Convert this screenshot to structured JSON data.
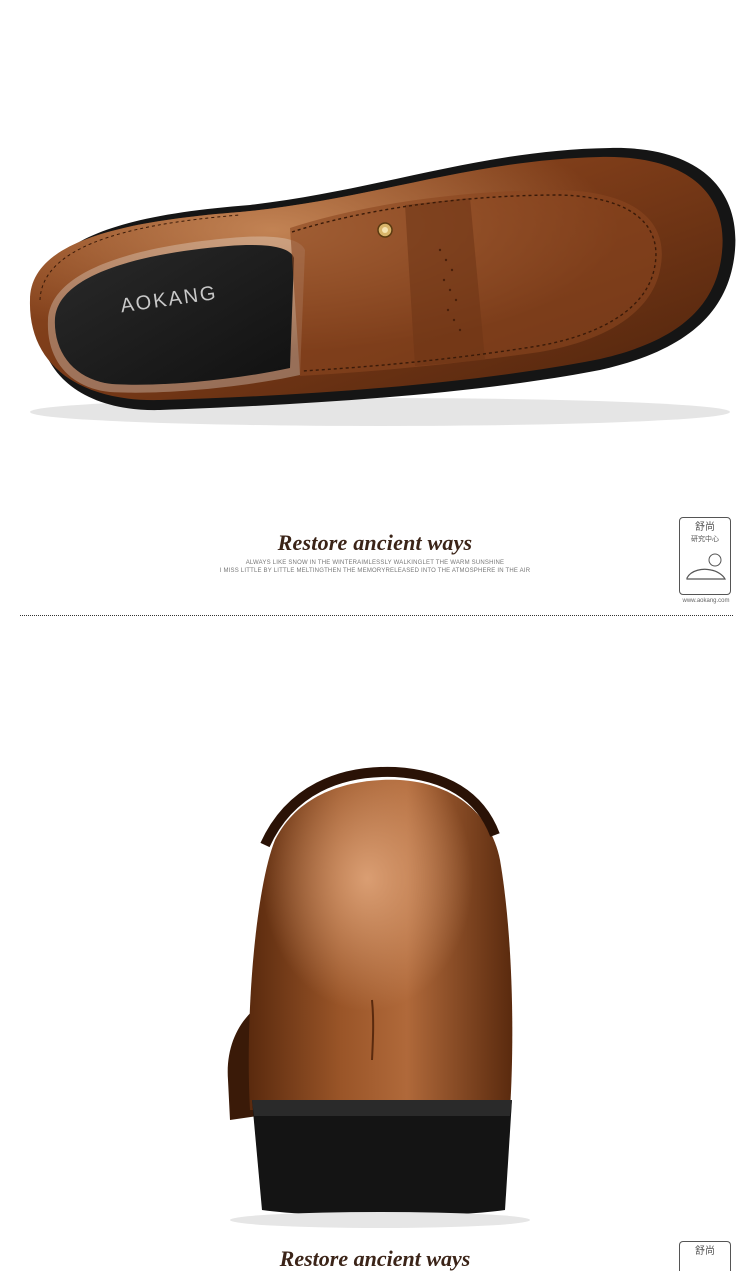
{
  "brand": {
    "insole_logo": "AOKANG",
    "badge_text_cn": "舒尚",
    "badge_sub_cn": "研究中心",
    "badge_url": "www.aokang.com"
  },
  "tagline": {
    "title": "Restore ancient ways",
    "line1": "ALWAYS LIKE SNOW IN THE WINTERAIMLESSLY WALKINGLET THE WARM SUNSHINE",
    "line2": "I MISS LITTLE BY LITTLE MELTINGTHEN THE MEMORYRELEASED INTO THE ATMOSPHERE IN THE AIR"
  },
  "tagline_repeat": {
    "title": "Restore ancient ways"
  },
  "colors": {
    "leather": "#7a3f1c",
    "leather_light": "#a85a2a",
    "sole": "#1a1a1a",
    "text_dark": "#3b2418"
  }
}
